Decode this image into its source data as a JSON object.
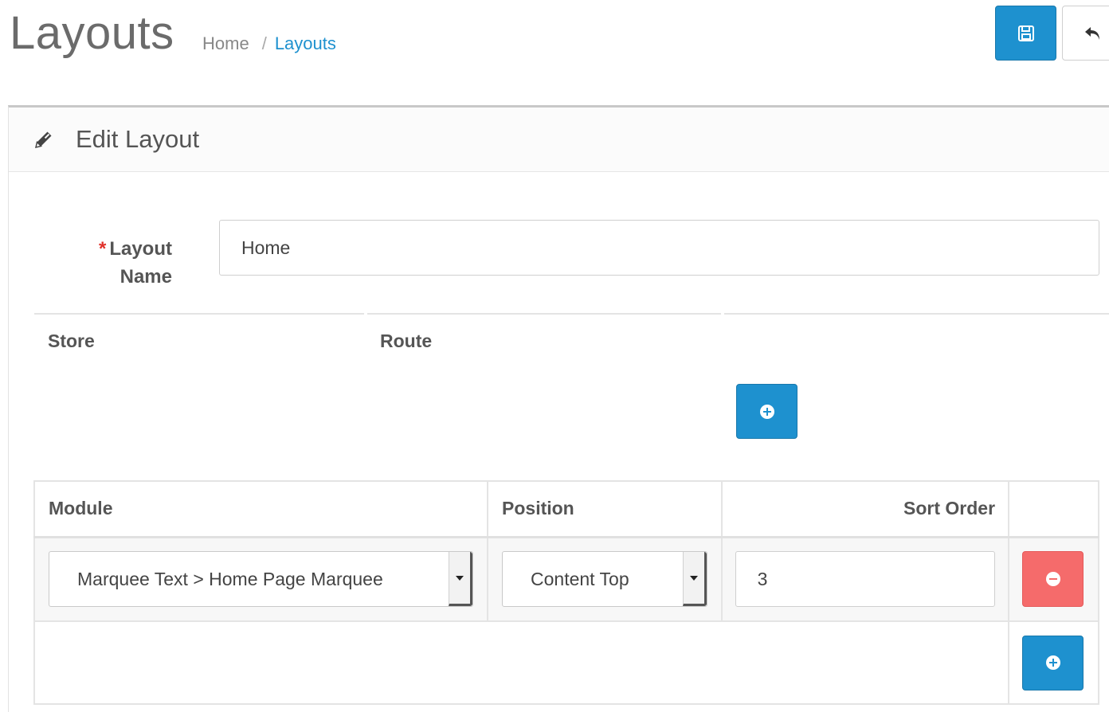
{
  "header": {
    "title": "Layouts",
    "breadcrumb": [
      {
        "label": "Home"
      },
      {
        "label": "Layouts"
      }
    ],
    "breadcrumb_separator": "/"
  },
  "toolbar": {
    "save_icon": "floppy-disk-icon",
    "back_icon": "reply-arrow-icon",
    "save_color": "#1e91cf"
  },
  "panel": {
    "heading": "Edit Layout",
    "heading_icon": "pencil-icon"
  },
  "form": {
    "layout_name_label_line1": "Layout",
    "layout_name_label_line2": "Name",
    "required_mark": "*",
    "layout_name_value": "Home"
  },
  "routes_table": {
    "columns": [
      "Store",
      "Route"
    ]
  },
  "modules_table": {
    "columns": [
      "Module",
      "Position",
      "Sort Order"
    ],
    "rows": [
      {
        "module": "Marquee Text > Home Page Marquee",
        "position": "Content Top",
        "sort_order": "3"
      }
    ]
  },
  "colors": {
    "primary": "#1e91cf",
    "danger": "#f56b6b",
    "required": "#e1322b"
  }
}
